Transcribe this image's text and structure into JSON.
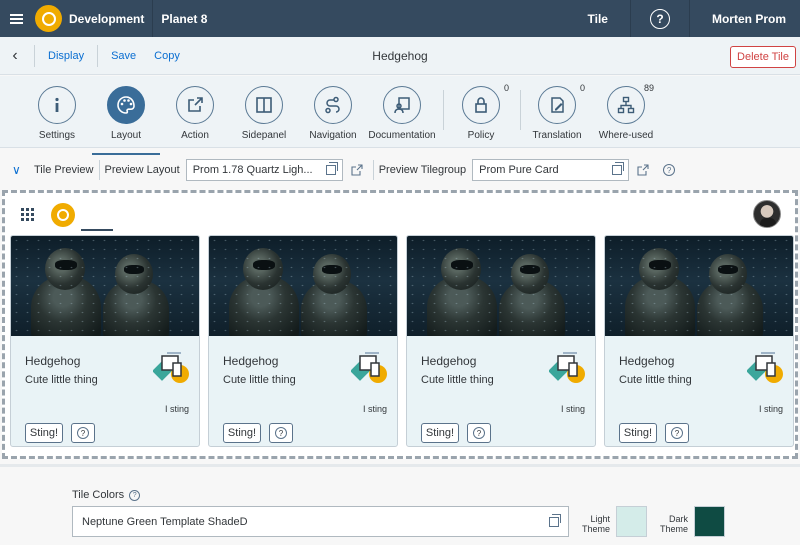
{
  "shell": {
    "app_title": "Development",
    "system": "Planet 8",
    "tile_label": "Tile",
    "help": "?",
    "user": "Morten Prom",
    "accent": "#f0ab00",
    "bg": "#354a5f"
  },
  "toolbar": {
    "display": "Display",
    "save": "Save",
    "copy": "Copy",
    "title": "Hedgehog",
    "delete": "Delete Tile"
  },
  "tabs": [
    {
      "label": "Settings",
      "icon": "info-icon"
    },
    {
      "label": "Layout",
      "icon": "palette-icon",
      "active": true
    },
    {
      "label": "Action",
      "icon": "share-icon"
    },
    {
      "label": "Sidepanel",
      "icon": "split-panel-icon"
    },
    {
      "label": "Navigation",
      "icon": "route-icon"
    },
    {
      "label": "Documentation",
      "icon": "documentation-icon"
    },
    {
      "label": "Policy",
      "icon": "lock-icon",
      "count": "0"
    },
    {
      "label": "Translation",
      "icon": "edit-document-icon",
      "count": "0"
    },
    {
      "label": "Where-used",
      "icon": "hierarchy-icon",
      "count": "89"
    }
  ],
  "preview": {
    "tile_preview": "Tile Preview",
    "preview_layout_label": "Preview Layout",
    "preview_layout_value": "Prom 1.78 Quartz Ligh...",
    "preview_tilegroup_label": "Preview Tilegroup",
    "preview_tilegroup_value": "Prom Pure Card",
    "help": "?"
  },
  "tiles": [
    {
      "title": "Hedgehog",
      "subtitle": "Cute little thing",
      "info": "I sting",
      "button": "Sting!",
      "help": "?"
    },
    {
      "title": "Hedgehog",
      "subtitle": "Cute little thing",
      "info": "I sting",
      "button": "Sting!",
      "help": "?"
    },
    {
      "title": "Hedgehog",
      "subtitle": "Cute little thing",
      "info": "I sting",
      "button": "Sting!",
      "help": "?"
    },
    {
      "title": "Hedgehog",
      "subtitle": "Cute little thing",
      "info": "I sting",
      "button": "Sting!",
      "help": "?"
    }
  ],
  "tile_colors": {
    "label": "Tile Colors",
    "help": "?",
    "value": "Neptune Green Template ShadeD",
    "light_theme_label": "Light Theme",
    "dark_theme_label": "Dark Theme",
    "light_color": "#d4ece9",
    "dark_color": "#0f4b43"
  }
}
